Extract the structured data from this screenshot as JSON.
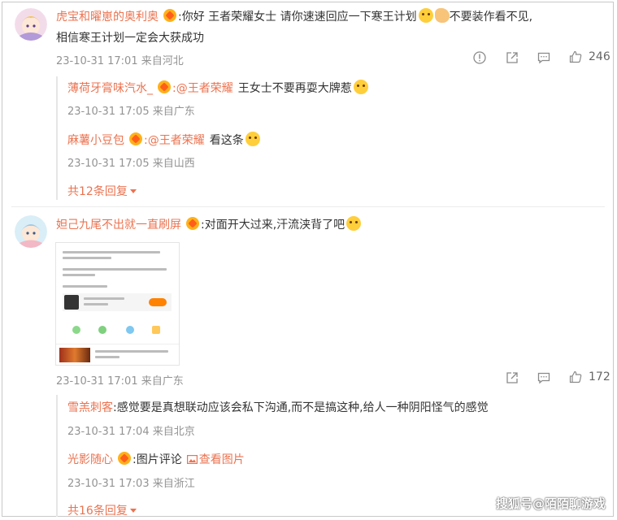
{
  "comments": [
    {
      "username": "虎宝和曜崽的奥利奥",
      "text_line1_a": ":你好 王者荣耀女士 请你速速回应一下寒王计划",
      "text_line1_b": "不要装作看不见,",
      "text_line2": "相信寒王计划一定会大获成功",
      "time": "23-10-31 17:01",
      "location": "来自河北",
      "like_count": "246",
      "replies": [
        {
          "username": "薄荷牙膏味汽水_",
          "mention": ":@王者荣耀",
          "text": "王女士不要再耍大牌惹",
          "time": "23-10-31 17:05",
          "location": "来自广东"
        },
        {
          "username": "麻薯小豆包",
          "mention": ":@王者荣耀",
          "text": "看这条",
          "time": "23-10-31 17:05",
          "location": "来自山西"
        }
      ],
      "more_replies": "共12条回复"
    },
    {
      "username": "妲己九尾不出就一直刷屏",
      "text": ":对面开大过来,汗流浃背了吧",
      "time": "23-10-31 17:01",
      "location": "来自广东",
      "like_count": "172",
      "replies": [
        {
          "username": "雪羔刺客",
          "text": ":感觉要是真想联动应该会私下沟通,而不是搞这种,给人一种阴阳怪气的感觉",
          "time": "23-10-31 17:04",
          "location": "来自北京"
        },
        {
          "username": "光影随心",
          "text": ":图片评论",
          "view_image": "查看图片",
          "time": "23-10-31 17:03",
          "location": "来自浙江"
        }
      ],
      "more_replies": "共16条回复"
    }
  ],
  "watermark": "搜狐号@陌陌聊游戏",
  "colors": {
    "accent": "#eb7350",
    "meta": "#939393",
    "vip": "#ffb11a"
  },
  "icons": [
    "report-icon",
    "share-icon",
    "comment-icon",
    "like-icon",
    "vip-crown-icon",
    "emoji-icon",
    "image-icon"
  ]
}
